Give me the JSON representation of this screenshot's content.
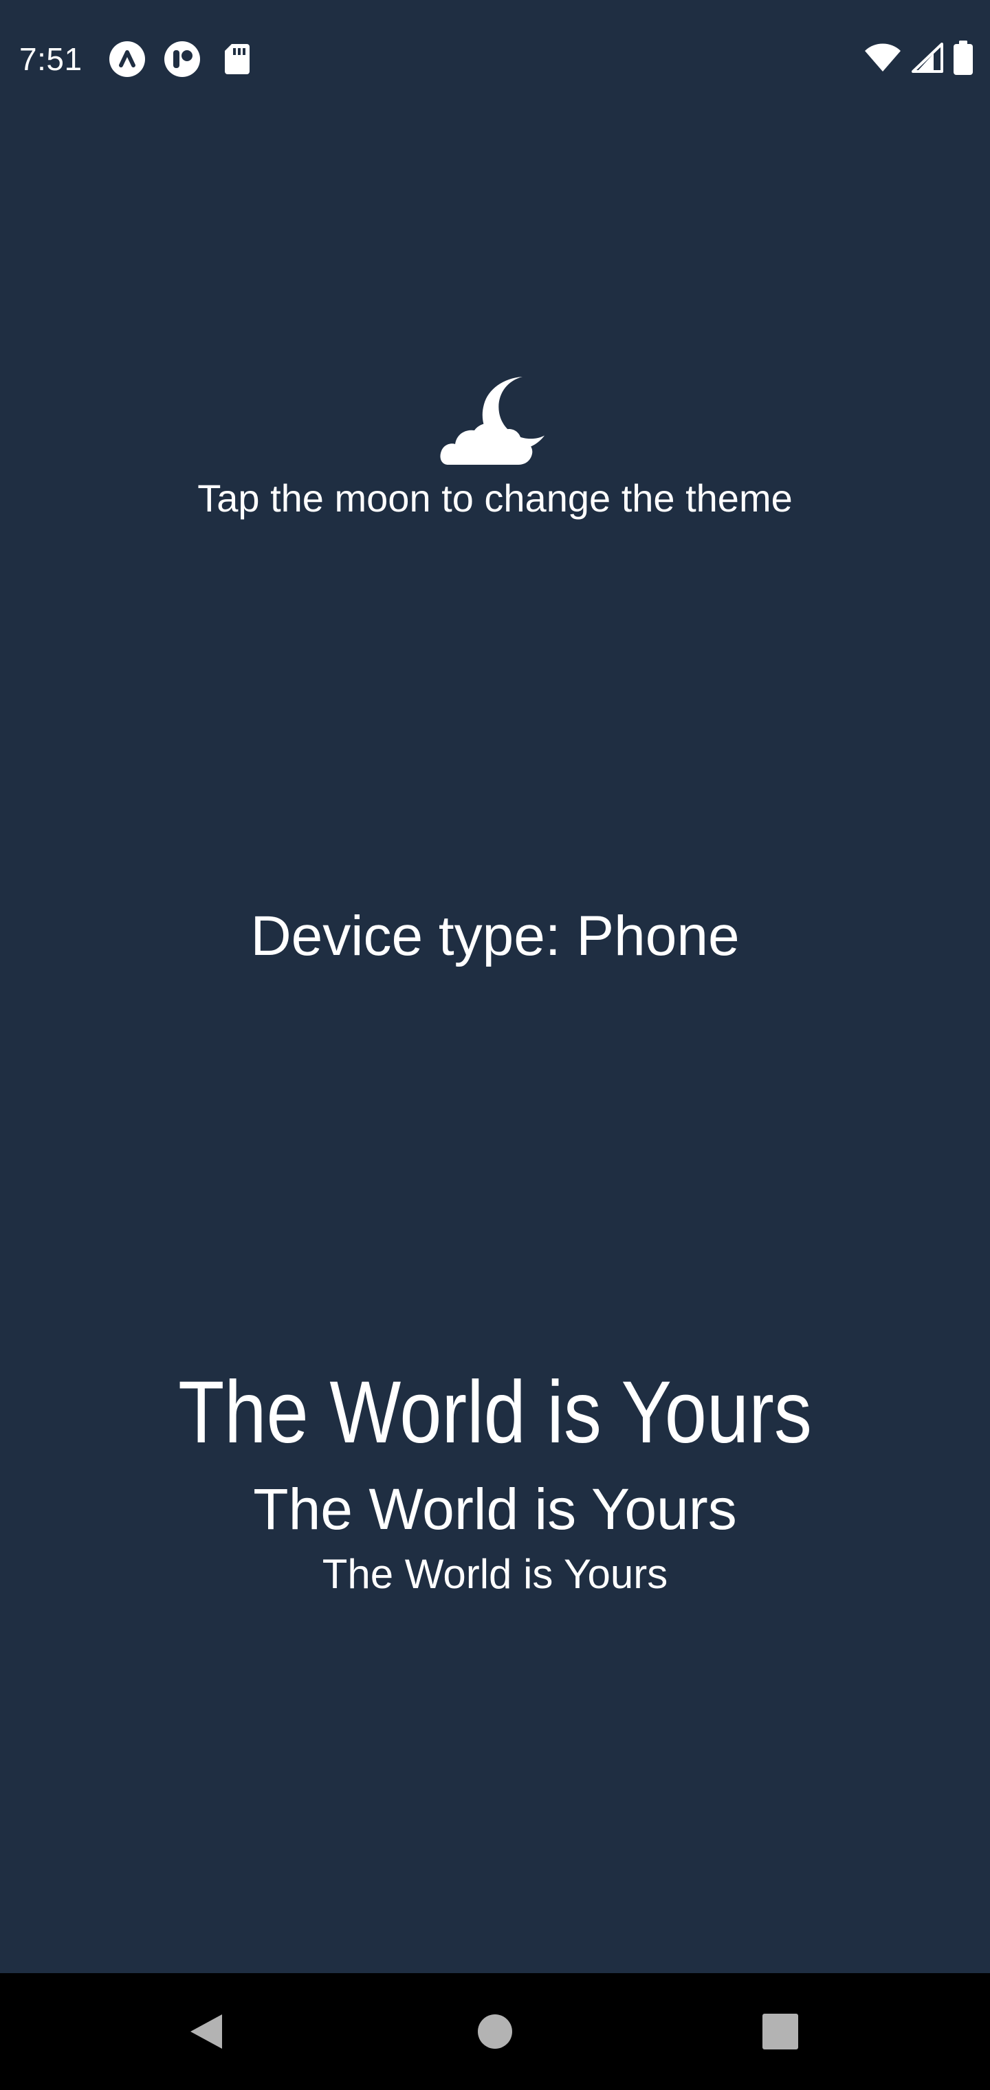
{
  "status_bar": {
    "time": "7:51",
    "left_icons": [
      "app-notification-icon",
      "app-notification-icon-2",
      "sd-card-icon"
    ],
    "right_icons": [
      "wifi-icon",
      "cell-signal-icon",
      "battery-icon"
    ]
  },
  "theme_toggle": {
    "icon": "moon-cloud-icon",
    "hint": "Tap the moon to change the theme"
  },
  "device": {
    "label": "Device type: Phone"
  },
  "samples": {
    "large": "The World is Yours",
    "medium": "The World is Yours",
    "small": "The World is Yours"
  },
  "nav_bar": {
    "icons": [
      "back-icon",
      "home-icon",
      "recents-icon"
    ]
  },
  "colors": {
    "background": "#1f2e42",
    "text": "#ffffff",
    "nav_background": "#000000",
    "nav_icons": "#b3b3b3"
  }
}
